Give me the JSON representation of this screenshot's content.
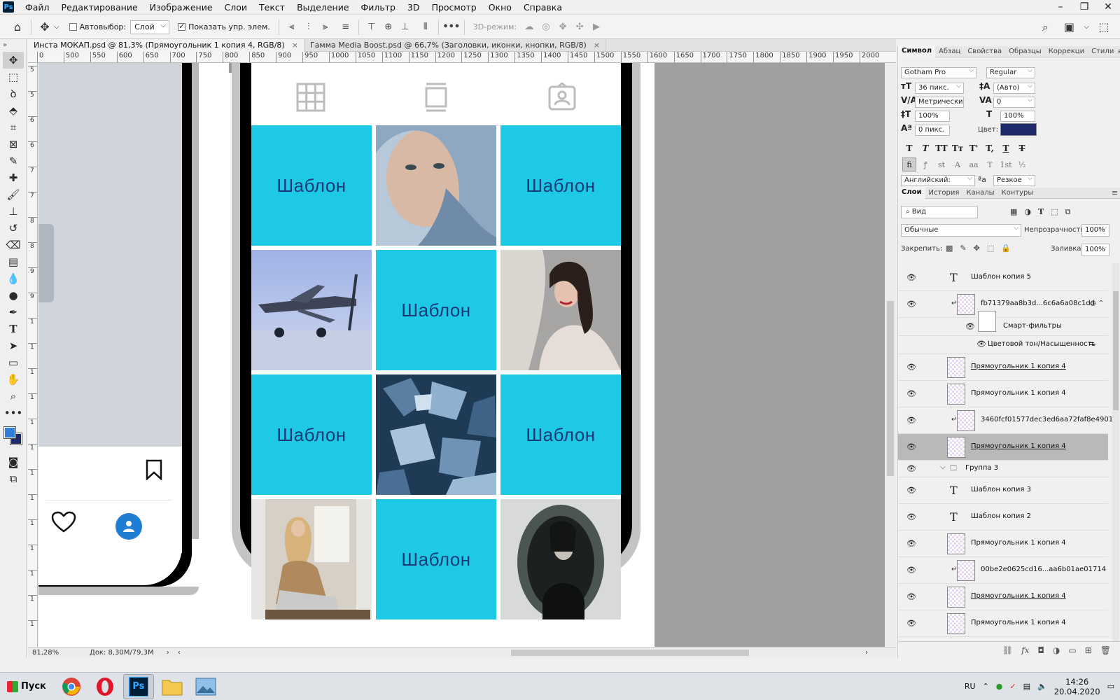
{
  "menu": {
    "items": [
      "Файл",
      "Редактирование",
      "Изображение",
      "Слои",
      "Текст",
      "Выделение",
      "Фильтр",
      "3D",
      "Просмотр",
      "Окно",
      "Справка"
    ],
    "logo": "Ps"
  },
  "options": {
    "autoselect_label": "Автовыбор:",
    "autoselect_value": "Слой",
    "show_controls_label": "Показать упр. элем.",
    "mode3d_label": "3D-режим:"
  },
  "tabs": [
    {
      "label": "Инста МОКАП.psd @ 81,3% (Прямоугольник 1 копия 4, RGB/8)",
      "close": "×"
    },
    {
      "label": "Гамма Media Boost.psd @ 66,7% (Заголовки, иконки, кнопки, RGB/8)",
      "close": "×"
    }
  ],
  "ruler_h": [
    "0",
    "500",
    "550",
    "600",
    "650",
    "700",
    "750",
    "800",
    "850",
    "900",
    "950",
    "1000",
    "1050",
    "1100",
    "1150",
    "1200",
    "1250",
    "1300",
    "1350",
    "1400",
    "1450",
    "1500",
    "1550",
    "1600",
    "1650",
    "1700",
    "1750",
    "1800",
    "1850",
    "1900",
    "1950",
    "2000"
  ],
  "ruler_v": [
    "5",
    "5",
    "6",
    "6",
    "7",
    "7",
    "8",
    "8",
    "9",
    "9",
    "1",
    "1",
    "1",
    "1",
    "1",
    "1",
    "1",
    "1",
    "1",
    "1",
    "1",
    "1",
    "1"
  ],
  "canvas": {
    "template_text": "Шаблон",
    "cells": [
      "tpl",
      "photo-face",
      "tpl",
      "photo-plane",
      "tpl",
      "photo-woman",
      "tpl",
      "photo-crystals",
      "tpl",
      "photo-girl",
      "tpl",
      "photo-mirror"
    ]
  },
  "symbol_panel": {
    "tabs": [
      "Символ",
      "Абзац",
      "Свойства",
      "Образцы",
      "Коррекци",
      "Стили"
    ],
    "font_family": "Gotham Pro",
    "font_style": "Regular",
    "font_size": "36 пикс.",
    "leading": "(Авто)",
    "kerning": "Метрически",
    "tracking": "0",
    "vscale": "100%",
    "hscale": "100%",
    "baseline": "0 пикс.",
    "color_label": "Цвет:",
    "color": "#1f2a6b",
    "language": "Английский: Вели...",
    "antialias": "Резкое",
    "aa_label": "ªa",
    "typo_buttons": [
      "T",
      "T",
      "TT",
      "Tт",
      "T'",
      "T,",
      "T",
      "T"
    ],
    "opentype_buttons": [
      "fi",
      "ꝭ",
      "st",
      "A",
      "aa",
      "T",
      "1st",
      "½"
    ]
  },
  "layers_panel": {
    "tabs": [
      "Слои",
      "История",
      "Каналы",
      "Контуры"
    ],
    "filter_kind": "Вид",
    "blend_mode": "Обычные",
    "opacity_label": "Непрозрачность:",
    "opacity": "100%",
    "lock_label": "Закрепить:",
    "fill_label": "Заливка:",
    "fill": "100%",
    "layers": [
      {
        "name": "Шаблон копия 5",
        "kind": "text"
      },
      {
        "name": "fb71379aa8b3d...6c6a6a08c1dd",
        "kind": "smart"
      },
      {
        "name": "Смарт-фильтры",
        "kind": "filters"
      },
      {
        "name": "Цветовой тон/Насыщенность",
        "kind": "filter-item"
      },
      {
        "name": "Прямоугольник 1 копия 4",
        "kind": "shape"
      },
      {
        "name": "Прямоугольник 1 копия 4",
        "kind": "shape"
      },
      {
        "name": "3460fcf01577dec3ed6aa72faf8e4901",
        "kind": "smart"
      },
      {
        "name": "Прямоугольник 1 копия 4",
        "kind": "shape-selected"
      },
      {
        "name": "Группа 3",
        "kind": "group"
      },
      {
        "name": "Шаблон копия 3",
        "kind": "text"
      },
      {
        "name": "Шаблон копия 2",
        "kind": "text"
      },
      {
        "name": "Прямоугольник 1 копия 4",
        "kind": "shape"
      },
      {
        "name": "00be2e0625cd16...aa6b01ae01714",
        "kind": "smart"
      },
      {
        "name": "Прямоугольник 1 копия 4",
        "kind": "shape"
      },
      {
        "name": "Прямоугольник 1 копия 4",
        "kind": "shape"
      }
    ]
  },
  "status": {
    "zoom": "81,28%",
    "doc": "Док: 8,30М/79,3М"
  },
  "taskbar": {
    "start": "Пуск",
    "lang": "RU",
    "time": "14:26",
    "date": "20.04.2020"
  }
}
